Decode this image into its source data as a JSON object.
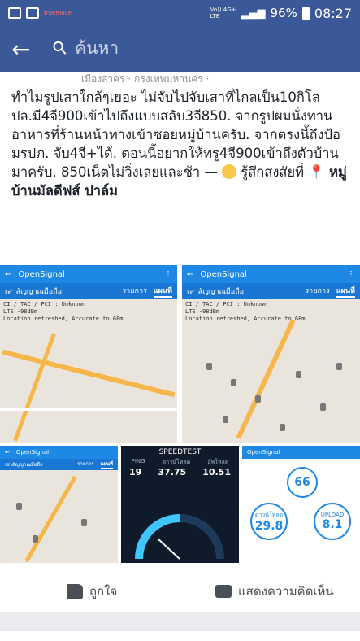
{
  "status_bar": {
    "carrier": "truemove",
    "network_top": "Vo)) 4G+",
    "network_bottom": "LTE",
    "battery": "96%",
    "time": "08:27"
  },
  "top_bar": {
    "search_placeholder": "ค้นหา"
  },
  "post": {
    "location_line": "เมืองสาคร · กรุงเทพมหานคร ·",
    "text_main": "ทำไมรูปเสาใกล้ๆเยอะ ไม่จับไปจับเสาที่ไกลเป็น10กิโล ปล.มี4จี900เข้าไปถึงแบบสลับ3จี850. จากรูปผมนั่งทานอาหารที่ร้านหน้าทางเข้าซอยหมู่บ้านครับ. จากตรงนี้ถึงป้อมรปภ. จับ4จี+ได้. ตอนนี้อยากให้ทรู4จี900เข้าถึงตัวบ้านมาครับ. 850เน็ตไม่วิ่งเลยและช้า —",
    "feeling": "รู้สึกสงสัยที่",
    "place": "หมู่บ้านมัลดีฟส์ ปาล์ม"
  },
  "screenshots": {
    "app_title": "OpenSignal",
    "tab_label": "เสาสัญญาณมือถือ",
    "list_tab": "รายการ",
    "map_tab": "แผนที่",
    "info_line1": "CI / TAC / PCI : Unknown",
    "info_line2": "LTE -98dBm",
    "info_line3": "Location refreshed, Accurate to 68m",
    "speedtest_title": "SPEEDTEST",
    "ping_label": "PING",
    "ping_value": "19",
    "download_label": "ดาวน์โหลด",
    "download_value": "37.75",
    "upload_label": "อัพโหลด",
    "upload_value": "10.51",
    "unit": "Mbps",
    "center_value": "66",
    "dl_circle_label": "ดาวน์โหลด",
    "dl_circle_value": "29.8",
    "ul_circle_label": "UPLOAD",
    "ul_circle_value": "8.1"
  },
  "actions": {
    "like_label": "ถูกใจ",
    "comment_label": "แสดงความคิดเห็น"
  }
}
